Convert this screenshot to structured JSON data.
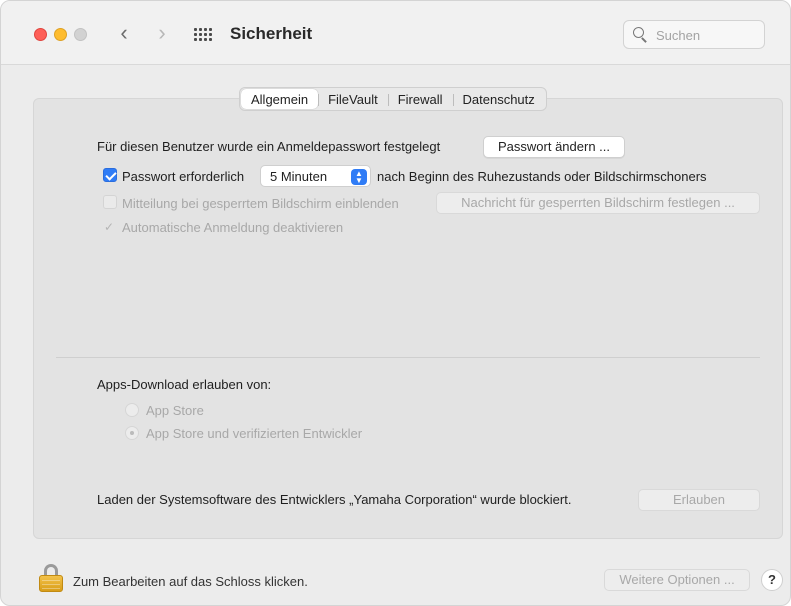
{
  "window": {
    "title": "Sicherheit",
    "search_placeholder": "Suchen",
    "icons": {
      "back": "chevron-left-icon",
      "forward": "chevron-right-icon",
      "all_prefs": "grid-icon",
      "search": "search-icon"
    }
  },
  "tabs": [
    {
      "label": "Allgemein",
      "active": true
    },
    {
      "label": "FileVault",
      "active": false
    },
    {
      "label": "Firewall",
      "active": false
    },
    {
      "label": "Datenschutz",
      "active": false
    }
  ],
  "general": {
    "password_set_text": "Für diesen Benutzer wurde ein Anmeldepasswort festgelegt",
    "change_password_button": "Passwort ändern ...",
    "require_password_label": "Passwort erforderlich",
    "require_password_checked": true,
    "require_password_delay": "5 Minuten",
    "require_password_suffix": "nach Beginn des Ruhezustands oder Bildschirmschoners",
    "lock_message_label": "Mitteilung bei gesperrtem Bildschirm einblenden",
    "lock_message_button": "Nachricht für gesperrten Bildschirm festlegen ...",
    "auto_login_label": "Automatische Anmeldung deaktivieren",
    "auto_login_check": "✓"
  },
  "apps_download": {
    "heading": "Apps-Download erlauben von:",
    "options": [
      {
        "label": "App Store",
        "selected": false
      },
      {
        "label": "App Store und verifizierten Entwickler",
        "selected": true
      }
    ]
  },
  "system_software": {
    "blocked_text": "Laden der Systemsoftware des Entwicklers „Yamaha Corporation“ wurde blockiert.",
    "allow_button": "Erlauben"
  },
  "footer": {
    "lock_text": "Zum Bearbeiten auf das Schloss klicken.",
    "more_options_button": "Weitere Optionen ...",
    "help_button": "?"
  },
  "colors": {
    "accent": "#2f7cf6",
    "close": "#fe5f57",
    "minimize": "#febc2e",
    "zoom_inactive": "#d2d2d2"
  }
}
